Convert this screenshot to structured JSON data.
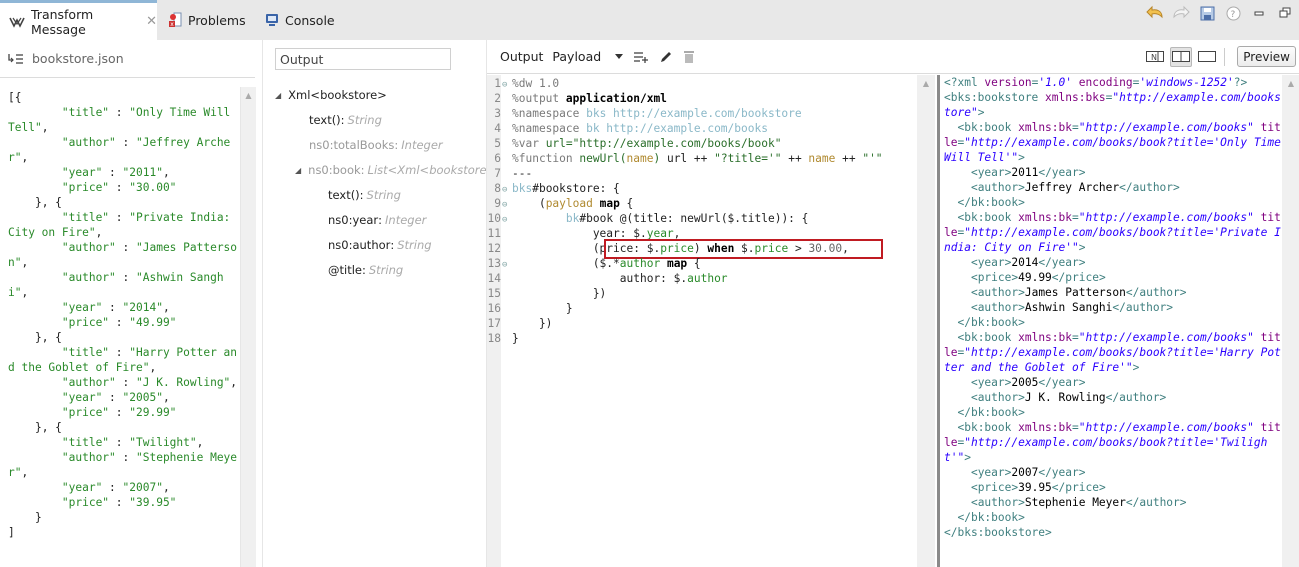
{
  "tabs": [
    {
      "label": "Transform Message",
      "icon": "transform-icon",
      "active": true,
      "closable": true
    },
    {
      "label": "Problems",
      "icon": "problems-icon",
      "active": false
    },
    {
      "label": "Console",
      "icon": "console-icon",
      "active": false
    }
  ],
  "top_icons": [
    "undo-icon",
    "redo-icon",
    "save-icon",
    "help-icon",
    "minimize-icon",
    "restore-icon"
  ],
  "input_pane": {
    "file_name": "bookstore.json",
    "json_lines": [
      [
        [
          "t",
          "[{"
        ]
      ],
      [
        [
          "t",
          "        "
        ],
        [
          "s",
          "\"title\""
        ],
        [
          "t",
          " : "
        ],
        [
          "s",
          "\"Only Time Will Tell\""
        ],
        [
          "t",
          ","
        ]
      ],
      [
        [
          "t",
          "        "
        ],
        [
          "s",
          "\"author\""
        ],
        [
          "t",
          " : "
        ],
        [
          "s",
          "\"Jeffrey Archer\""
        ],
        [
          "t",
          ","
        ]
      ],
      [
        [
          "t",
          "        "
        ],
        [
          "s",
          "\"year\""
        ],
        [
          "t",
          " : "
        ],
        [
          "s",
          "\"2011\""
        ],
        [
          "t",
          ","
        ]
      ],
      [
        [
          "t",
          "        "
        ],
        [
          "s",
          "\"price\""
        ],
        [
          "t",
          " : "
        ],
        [
          "s",
          "\"30.00\""
        ]
      ],
      [
        [
          "t",
          "    }, {"
        ]
      ],
      [
        [
          "t",
          "        "
        ],
        [
          "s",
          "\"title\""
        ],
        [
          "t",
          " : "
        ],
        [
          "s",
          "\"Private India: City on Fire\""
        ],
        [
          "t",
          ","
        ]
      ],
      [
        [
          "t",
          "        "
        ],
        [
          "s",
          "\"author\""
        ],
        [
          "t",
          " : "
        ],
        [
          "s",
          "\"James Patterson\""
        ],
        [
          "t",
          ","
        ]
      ],
      [
        [
          "t",
          "        "
        ],
        [
          "s",
          "\"author\""
        ],
        [
          "t",
          " : "
        ],
        [
          "s",
          "\"Ashwin Sanghi\""
        ],
        [
          "t",
          ","
        ]
      ],
      [
        [
          "t",
          "        "
        ],
        [
          "s",
          "\"year\""
        ],
        [
          "t",
          " : "
        ],
        [
          "s",
          "\"2014\""
        ],
        [
          "t",
          ","
        ]
      ],
      [
        [
          "t",
          "        "
        ],
        [
          "s",
          "\"price\""
        ],
        [
          "t",
          " : "
        ],
        [
          "s",
          "\"49.99\""
        ]
      ],
      [
        [
          "t",
          "    }, {"
        ]
      ],
      [
        [
          "t",
          "        "
        ],
        [
          "s",
          "\"title\""
        ],
        [
          "t",
          " : "
        ],
        [
          "s",
          "\"Harry Potter and the Goblet of Fire\""
        ],
        [
          "t",
          ","
        ]
      ],
      [
        [
          "t",
          "        "
        ],
        [
          "s",
          "\"author\""
        ],
        [
          "t",
          " : "
        ],
        [
          "s",
          "\"J K. Rowling\""
        ],
        [
          "t",
          ","
        ]
      ],
      [
        [
          "t",
          "        "
        ],
        [
          "s",
          "\"year\""
        ],
        [
          "t",
          " : "
        ],
        [
          "s",
          "\"2005\""
        ],
        [
          "t",
          ","
        ]
      ],
      [
        [
          "t",
          "        "
        ],
        [
          "s",
          "\"price\""
        ],
        [
          "t",
          " : "
        ],
        [
          "s",
          "\"29.99\""
        ]
      ],
      [
        [
          "t",
          "    }, {"
        ]
      ],
      [
        [
          "t",
          "        "
        ],
        [
          "s",
          "\"title\""
        ],
        [
          "t",
          " : "
        ],
        [
          "s",
          "\"Twilight\""
        ],
        [
          "t",
          ","
        ]
      ],
      [
        [
          "t",
          "        "
        ],
        [
          "s",
          "\"author\""
        ],
        [
          "t",
          " : "
        ],
        [
          "s",
          "\"Stephenie Meyer\""
        ],
        [
          "t",
          ","
        ]
      ],
      [
        [
          "t",
          "        "
        ],
        [
          "s",
          "\"year\""
        ],
        [
          "t",
          " : "
        ],
        [
          "s",
          "\"2007\""
        ],
        [
          "t",
          ","
        ]
      ],
      [
        [
          "t",
          "        "
        ],
        [
          "s",
          "\"price\""
        ],
        [
          "t",
          " : "
        ],
        [
          "s",
          "\"39.95\""
        ]
      ],
      [
        [
          "t",
          "    }"
        ]
      ],
      [
        [
          "t",
          "]"
        ]
      ]
    ]
  },
  "metadata_pane": {
    "search_value": "Output",
    "tree": [
      {
        "name": "Xml<bookstore>",
        "type": "",
        "depth": 0,
        "expanded": true,
        "dim": false
      },
      {
        "name": "text()",
        "type": "String",
        "depth": 1,
        "dim": false
      },
      {
        "name": "ns0:totalBooks",
        "type": "Integer",
        "depth": 1,
        "dim": true
      },
      {
        "name": "ns0:book",
        "type": "List<Xml<bookstore>>",
        "depth": 1,
        "expanded": true,
        "dim": true
      },
      {
        "name": "text()",
        "type": "String",
        "depth": 2,
        "dim": false
      },
      {
        "name": "ns0:year",
        "type": "Integer",
        "depth": 2,
        "dim": false
      },
      {
        "name": "ns0:author",
        "type": "String",
        "depth": 2,
        "dim": false
      },
      {
        "name": "@title",
        "type": "String",
        "depth": 2,
        "dim": false
      }
    ]
  },
  "editor": {
    "output_label": "Output",
    "payload_label": "Payload",
    "toolbar_icons": [
      "dropdown-icon",
      "add-output-icon",
      "edit-icon",
      "delete-icon"
    ],
    "view_toggles": [
      "source-only-icon",
      "split-view-icon",
      "single-view-icon"
    ],
    "preview_label": "Preview",
    "code_lines": [
      {
        "n": "1",
        "fold": true,
        "parts": [
          [
            "dir",
            "%dw "
          ],
          [
            "dir",
            "1.0"
          ]
        ]
      },
      {
        "n": "2",
        "fold": false,
        "parts": [
          [
            "dir",
            "%output "
          ],
          [
            "kb",
            "application/xml"
          ]
        ]
      },
      {
        "n": "3",
        "fold": false,
        "parts": [
          [
            "dir",
            "%namespace "
          ],
          [
            "ns",
            "bks http://example.com/bookstore"
          ]
        ]
      },
      {
        "n": "4",
        "fold": false,
        "parts": [
          [
            "dir",
            "%namespace "
          ],
          [
            "ns",
            "bk http://example.com/books"
          ]
        ]
      },
      {
        "n": "5",
        "fold": false,
        "parts": [
          [
            "dir",
            "%var "
          ],
          [
            "str",
            "url=\"http://example.com/books/book\""
          ]
        ]
      },
      {
        "n": "6",
        "fold": false,
        "parts": [
          [
            "dir",
            "%function "
          ],
          [
            "fn",
            "newUrl("
          ],
          [
            "var",
            "name"
          ],
          [
            "fn",
            ") "
          ],
          [
            "txt",
            "url ++ "
          ],
          [
            "str",
            "\"?title='\""
          ],
          [
            "txt",
            " ++ "
          ],
          [
            "var",
            "name"
          ],
          [
            "txt",
            " ++ "
          ],
          [
            "str",
            "\"'\""
          ]
        ]
      },
      {
        "n": "7",
        "fold": false,
        "parts": [
          [
            "txt",
            "---"
          ]
        ]
      },
      {
        "n": "8",
        "fold": true,
        "parts": [
          [
            "ns",
            "bks"
          ],
          [
            "txt",
            "#bookstore: {"
          ]
        ]
      },
      {
        "n": "9",
        "fold": true,
        "parts": [
          [
            "txt",
            "    ("
          ],
          [
            "var",
            "payload"
          ],
          [
            "txt",
            " "
          ],
          [
            "kb",
            "map"
          ],
          [
            "txt",
            " {"
          ]
        ]
      },
      {
        "n": "10",
        "fold": true,
        "parts": [
          [
            "txt",
            "        "
          ],
          [
            "ns",
            "bk"
          ],
          [
            "txt",
            "#book @(title: newUrl($.title)): {"
          ]
        ]
      },
      {
        "n": "11",
        "fold": false,
        "parts": [
          [
            "txt",
            "            year: $."
          ],
          [
            "sk",
            "year"
          ],
          [
            "txt",
            ","
          ]
        ]
      },
      {
        "n": "12",
        "fold": false,
        "parts": [
          [
            "txt",
            "            (price: $."
          ],
          [
            "sk",
            "price"
          ],
          [
            "txt",
            ") "
          ],
          [
            "kb",
            "when"
          ],
          [
            "txt",
            " $."
          ],
          [
            "sk",
            "price"
          ],
          [
            "txt",
            " > "
          ],
          [
            "num",
            "30.00"
          ],
          [
            "txt",
            ","
          ]
        ]
      },
      {
        "n": "13",
        "fold": true,
        "parts": [
          [
            "txt",
            "            ($.*"
          ],
          [
            "sk",
            "author"
          ],
          [
            "txt",
            " "
          ],
          [
            "kb",
            "map"
          ],
          [
            "txt",
            " {"
          ]
        ]
      },
      {
        "n": "14",
        "fold": false,
        "parts": [
          [
            "txt",
            "                author: $."
          ],
          [
            "sk",
            "author"
          ]
        ]
      },
      {
        "n": "15",
        "fold": false,
        "parts": [
          [
            "txt",
            "            })"
          ]
        ]
      },
      {
        "n": "16",
        "fold": false,
        "parts": [
          [
            "txt",
            "        }"
          ]
        ]
      },
      {
        "n": "17",
        "fold": false,
        "parts": [
          [
            "txt",
            "    })"
          ]
        ]
      },
      {
        "n": "18",
        "fold": false,
        "parts": [
          [
            "txt",
            "}"
          ]
        ]
      }
    ],
    "highlighted_line": "12",
    "preview_lines": [
      [
        [
          "tag",
          "<?xml "
        ],
        [
          "attr",
          "version"
        ],
        [
          "tag",
          "="
        ],
        [
          "val",
          "'1.0'"
        ],
        [
          "tag",
          " "
        ],
        [
          "attr",
          "encoding"
        ],
        [
          "tag",
          "="
        ],
        [
          "val",
          "'windows-1252'"
        ],
        [
          "tag",
          "?>"
        ]
      ],
      [
        [
          "tag",
          "<bks:bookstore "
        ],
        [
          "attr",
          "xmlns:bks"
        ],
        [
          "tag",
          "="
        ],
        [
          "val",
          "\"http://example.com/bookstore\""
        ],
        [
          "tag",
          ">"
        ]
      ],
      [
        [
          "tag",
          "  <bk:book "
        ],
        [
          "attr",
          "xmlns:bk"
        ],
        [
          "tag",
          "="
        ],
        [
          "val",
          "\"http://example.com/books\""
        ],
        [
          "tag",
          " "
        ],
        [
          "attr",
          "title"
        ],
        [
          "tag",
          "="
        ],
        [
          "val",
          "\"http://example.com/books/book?title='Only Time Will Tell'\""
        ],
        [
          "tag",
          ">"
        ]
      ],
      [
        [
          "tag",
          "    <year>"
        ],
        [
          "txt",
          "2011"
        ],
        [
          "tag",
          "</year>"
        ]
      ],
      [
        [
          "tag",
          "    <author>"
        ],
        [
          "txt",
          "Jeffrey Archer"
        ],
        [
          "tag",
          "</author>"
        ]
      ],
      [
        [
          "tag",
          "  </bk:book>"
        ]
      ],
      [
        [
          "tag",
          "  <bk:book "
        ],
        [
          "attr",
          "xmlns:bk"
        ],
        [
          "tag",
          "="
        ],
        [
          "val",
          "\"http://example.com/books\""
        ],
        [
          "tag",
          " "
        ],
        [
          "attr",
          "title"
        ],
        [
          "tag",
          "="
        ],
        [
          "val",
          "\"http://example.com/books/book?title='Private India: City on Fire'\""
        ],
        [
          "tag",
          ">"
        ]
      ],
      [
        [
          "tag",
          "    <year>"
        ],
        [
          "txt",
          "2014"
        ],
        [
          "tag",
          "</year>"
        ]
      ],
      [
        [
          "tag",
          "    <price>"
        ],
        [
          "txt",
          "49.99"
        ],
        [
          "tag",
          "</price>"
        ]
      ],
      [
        [
          "tag",
          "    <author>"
        ],
        [
          "txt",
          "James Patterson"
        ],
        [
          "tag",
          "</author>"
        ]
      ],
      [
        [
          "tag",
          "    <author>"
        ],
        [
          "txt",
          "Ashwin Sanghi"
        ],
        [
          "tag",
          "</author>"
        ]
      ],
      [
        [
          "tag",
          "  </bk:book>"
        ]
      ],
      [
        [
          "tag",
          "  <bk:book "
        ],
        [
          "attr",
          "xmlns:bk"
        ],
        [
          "tag",
          "="
        ],
        [
          "val",
          "\"http://example.com/books\""
        ],
        [
          "tag",
          " "
        ],
        [
          "attr",
          "title"
        ],
        [
          "tag",
          "="
        ],
        [
          "val",
          "\"http://example.com/books/book?title='Harry Potter and the Goblet of Fire'\""
        ],
        [
          "tag",
          ">"
        ]
      ],
      [
        [
          "tag",
          "    <year>"
        ],
        [
          "txt",
          "2005"
        ],
        [
          "tag",
          "</year>"
        ]
      ],
      [
        [
          "tag",
          "    <author>"
        ],
        [
          "txt",
          "J K. Rowling"
        ],
        [
          "tag",
          "</author>"
        ]
      ],
      [
        [
          "tag",
          "  </bk:book>"
        ]
      ],
      [
        [
          "tag",
          "  <bk:book "
        ],
        [
          "attr",
          "xmlns:bk"
        ],
        [
          "tag",
          "="
        ],
        [
          "val",
          "\"http://example.com/books\""
        ],
        [
          "tag",
          " "
        ],
        [
          "attr",
          "title"
        ],
        [
          "tag",
          "="
        ],
        [
          "val",
          "\"http://example.com/books/book?title='Twilight'\""
        ],
        [
          "tag",
          ">"
        ]
      ],
      [
        [
          "tag",
          "    <year>"
        ],
        [
          "txt",
          "2007"
        ],
        [
          "tag",
          "</year>"
        ]
      ],
      [
        [
          "tag",
          "    <price>"
        ],
        [
          "txt",
          "39.95"
        ],
        [
          "tag",
          "</price>"
        ]
      ],
      [
        [
          "tag",
          "    <author>"
        ],
        [
          "txt",
          "Stephenie Meyer"
        ],
        [
          "tag",
          "</author>"
        ]
      ],
      [
        [
          "tag",
          "  </bk:book>"
        ]
      ],
      [
        [
          "tag",
          "</bks:bookstore>"
        ]
      ]
    ]
  },
  "colors": {
    "highlight_box": "#c01b22",
    "active_tab_accent": "#8fb6d6"
  }
}
